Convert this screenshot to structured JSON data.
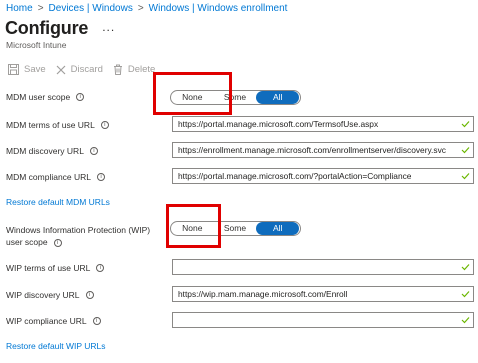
{
  "breadcrumb": [
    "Home",
    "Devices | Windows",
    "Windows | Windows enrollment"
  ],
  "header": {
    "title": "Configure",
    "more": "...",
    "subtitle": "Microsoft Intune"
  },
  "toolbar": {
    "save": "Save",
    "discard": "Discard",
    "delete": "Delete"
  },
  "mdm": {
    "scope_label": "MDM user scope",
    "scope_options": [
      "None",
      "Some",
      "All"
    ],
    "scope_selected": "All",
    "terms_label": "MDM terms of use URL",
    "terms_value": "https://portal.manage.microsoft.com/TermsofUse.aspx",
    "discovery_label": "MDM discovery URL",
    "discovery_value": "https://enrollment.manage.microsoft.com/enrollmentserver/discovery.svc",
    "compliance_label": "MDM compliance URL",
    "compliance_value": "https://portal.manage.microsoft.com/?portalAction=Compliance",
    "restore": "Restore default MDM URLs"
  },
  "wip": {
    "scope_label": "Windows Information Protection (WIP) user scope",
    "scope_options": [
      "None",
      "Some",
      "All"
    ],
    "scope_selected": "All",
    "terms_label": "WIP terms of use URL",
    "terms_value": "",
    "discovery_label": "WIP discovery URL",
    "discovery_value": "https://wip.mam.manage.microsoft.com/Enroll",
    "compliance_label": "WIP compliance URL",
    "compliance_value": "",
    "restore": "Restore default WIP URLs"
  },
  "colors": {
    "accent": "#0f6cbd",
    "link": "#0078d4",
    "highlight": "#e00000",
    "check": "#6bb700"
  }
}
